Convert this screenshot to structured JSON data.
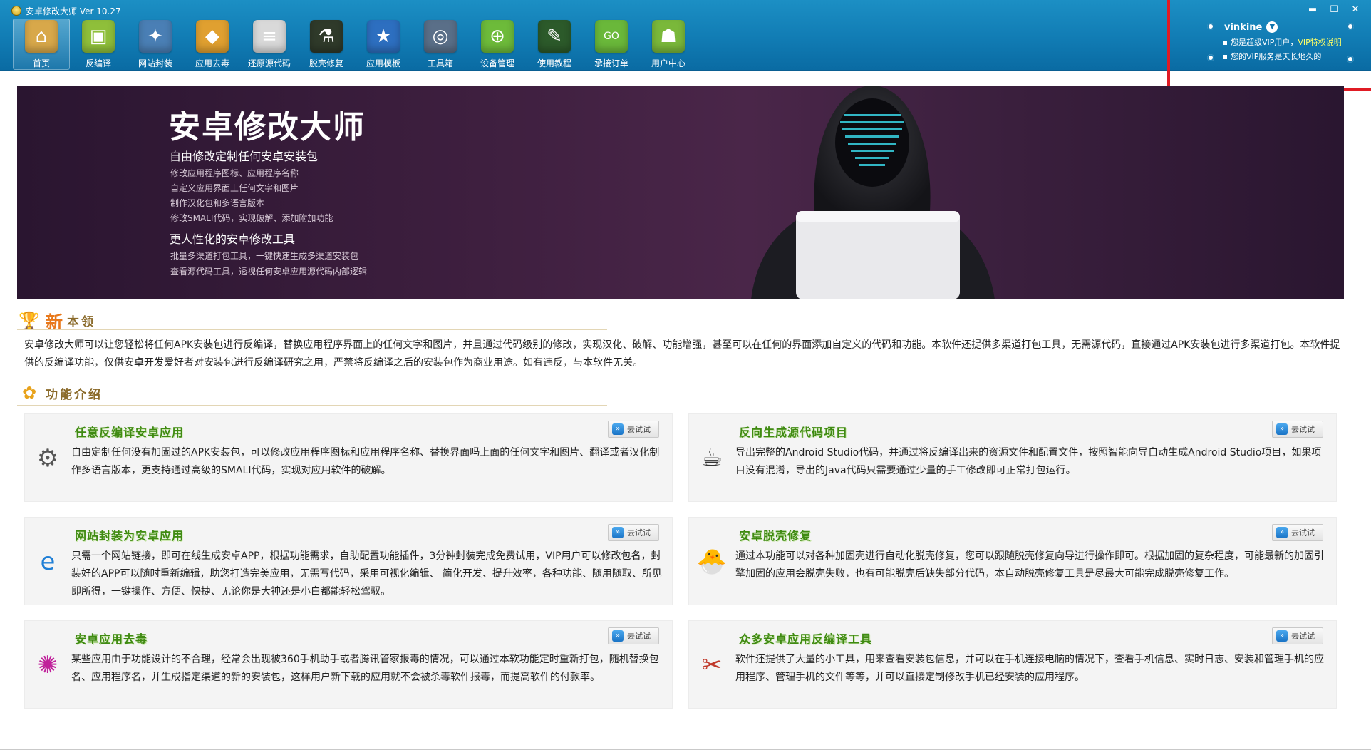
{
  "window": {
    "title": "安卓修改大师 Ver 10.27",
    "controls": {
      "minimize": "▬",
      "maximize": "☐",
      "close": "✕"
    }
  },
  "toolbar": {
    "items": [
      {
        "label": "首页",
        "icon": "home-icon",
        "color": "#d8a84a",
        "glyph": "⌂"
      },
      {
        "label": "反编译",
        "icon": "android-box-icon",
        "color": "#8fbf3a",
        "glyph": "▣"
      },
      {
        "label": "网站封装",
        "icon": "web-package-icon",
        "color": "#4a7fb5",
        "glyph": "✦"
      },
      {
        "label": "应用去毒",
        "icon": "box-icon",
        "color": "#e0a030",
        "glyph": "◆"
      },
      {
        "label": "还原源代码",
        "icon": "document-icon",
        "color": "#d9d9d9",
        "glyph": "≡"
      },
      {
        "label": "脱壳修复",
        "icon": "flask-icon",
        "color": "#2f3a2a",
        "glyph": "⚗"
      },
      {
        "label": "应用模板",
        "icon": "star-template-icon",
        "color": "#2d6fc0",
        "glyph": "★"
      },
      {
        "label": "工具箱",
        "icon": "toolbox-icon",
        "color": "#5a6f88",
        "glyph": "◎"
      },
      {
        "label": "设备管理",
        "icon": "device-icon",
        "color": "#6dbb3a",
        "glyph": "⊕"
      },
      {
        "label": "使用教程",
        "icon": "blackboard-icon",
        "color": "#2c5a2a",
        "glyph": "✎"
      },
      {
        "label": "承接订单",
        "icon": "shopping-bag-icon",
        "color": "#6ab83a",
        "glyph": "GO"
      },
      {
        "label": "用户中心",
        "icon": "android-robot-icon",
        "color": "#7ab83a",
        "glyph": "☗"
      }
    ],
    "active_index": 0
  },
  "user": {
    "name": "vinkine",
    "line1_prefix": "您是超级VIP用户，",
    "vip_link": "VIP特权说明",
    "line2": "您的VIP服务是天长地久的"
  },
  "banner": {
    "title": "安卓修改大师",
    "subtitle1": "自由修改定制任何安卓安装包",
    "lines1": [
      "修改应用程序图标、应用程序名称",
      "自定义应用界面上任何文字和图片",
      "制作汉化包和多语言版本",
      "修改SMALI代码，实现破解、添加附加功能"
    ],
    "subtitle2": "更人性化的安卓修改工具",
    "lines2": [
      "批量多渠道打包工具，一键快速生成多渠道安装包",
      "查看源代码工具，透视任何安卓应用源代码内部逻辑"
    ]
  },
  "section_new": {
    "new_char": "新",
    "title": "本领"
  },
  "intro": "安卓修改大师可以让您轻松将任何APK安装包进行反编译，替换应用程序界面上的任何文字和图片，并且通过代码级别的修改，实现汉化、破解、功能增强，甚至可以在任何的界面添加自定义的代码和功能。本软件还提供多渠道打包工具，无需源代码，直接通过APK安装包进行多渠道打包。本软件提供的反编译功能，仅供安卓开发爱好者对安装包进行反编译研究之用，严禁将反编译之后的安装包作为商业用途。如有违反，与本软件无关。",
  "section_features": {
    "title": "功能介绍"
  },
  "try_label": "去试试",
  "cards": [
    {
      "title": "任意反编译安卓应用",
      "icon": "gear-box-icon",
      "glyph": "⚙",
      "desc": "自由定制任何没有加固过的APK安装包，可以修改应用程序图标和应用程序名称、替换界面吗上面的任何文字和图片、翻译或者汉化制作多语言版本，更支持通过高级的SMALI代码，实现对应用软件的破解。"
    },
    {
      "title": "反向生成源代码项目",
      "icon": "java-icon",
      "glyph": "☕",
      "desc": "导出完整的Android Studio代码，并通过将反编译出来的资源文件和配置文件，按照智能向导自动生成Android Studio项目，如果项目没有混淆，导出的Java代码只需要通过少量的手工修改即可正常打包运行。"
    },
    {
      "title": "网站封装为安卓应用",
      "icon": "ie-icon",
      "glyph": "e",
      "desc": "只需一个网站链接，即可在线生成安卓APP，根据功能需求，自助配置功能插件，3分钟封装完成免费试用，VIP用户可以修改包名，封装好的APP可以随时重新编辑，助您打造完美应用，无需写代码，采用可视化编辑、 简化开发、提升效率，各种功能、随用随取、所见即所得，一键操作、方便、快捷、无论你是大神还是小白都能轻松驾驭。"
    },
    {
      "title": "安卓脱壳修复",
      "icon": "chick-icon",
      "glyph": "🐣",
      "desc": "通过本功能可以对各种加固壳进行自动化脱壳修复，您可以跟随脱壳修复向导进行操作即可。根据加固的复杂程度，可能最新的加固引擎加固的应用会脱壳失败，也有可能脱壳后缺失部分代码，本自动脱壳修复工具是尽最大可能完成脱壳修复工作。"
    },
    {
      "title": "安卓应用去毒",
      "icon": "virus-icon",
      "glyph": "✺",
      "desc": "某些应用由于功能设计的不合理，经常会出现被360手机助手或者腾讯管家报毒的情况，可以通过本软功能定时重新打包，随机替换包名、应用程序名，并生成指定渠道的新的安装包，这样用户新下载的应用就不会被杀毒软件报毒，而提高软件的付款率。"
    },
    {
      "title": "众多安卓应用反编译工具",
      "icon": "tools-icon",
      "glyph": "✂",
      "desc": "软件还提供了大量的小工具，用来查看安装包信息，并可以在手机连接电脑的情况下，查看手机信息、实时日志、安装和管理手机的应用程序、管理手机的文件等等，并可以直接定制修改手机已经安装的应用程序。"
    }
  ]
}
